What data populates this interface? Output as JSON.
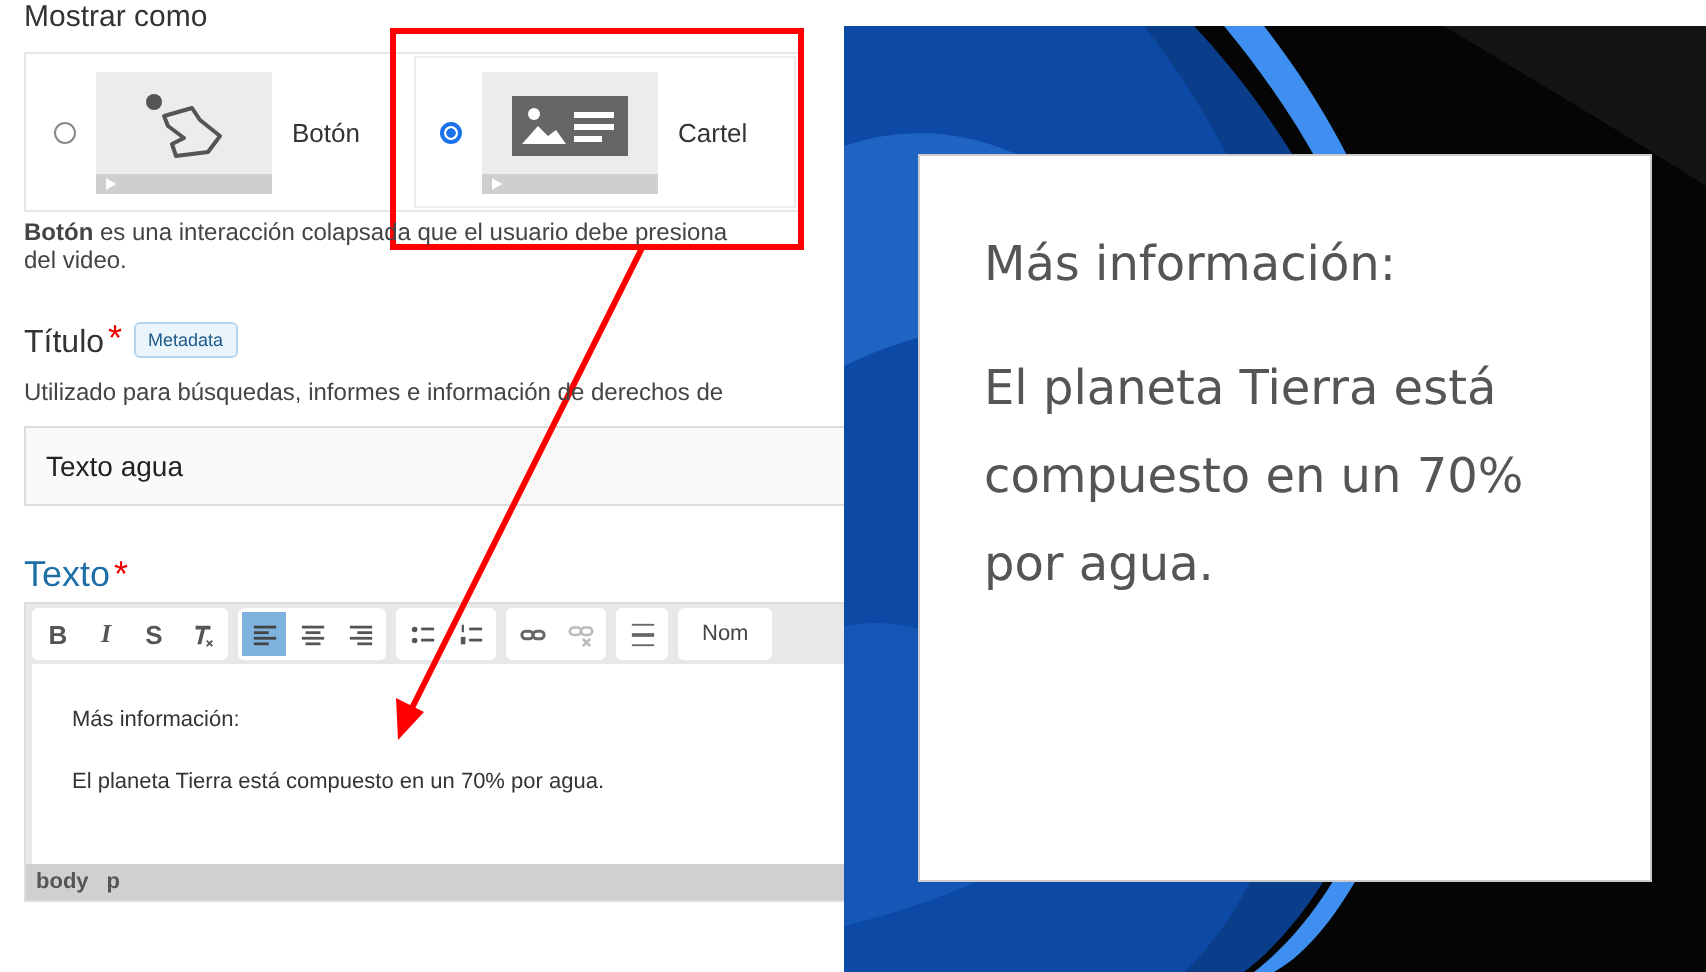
{
  "display_as": {
    "heading": "Mostrar como",
    "options": [
      {
        "label": "Botón",
        "kind": "button",
        "selected": false
      },
      {
        "label": "Cartel",
        "kind": "poster",
        "selected": true
      }
    ],
    "description": [
      "**Botón** es una interacción colapsada que el usuario debe presiona",
      "del video."
    ]
  },
  "title_field": {
    "label": "Título",
    "required_mark": "*",
    "badge": "Metadata",
    "help": "Utilizado para búsquedas, informes e información de derechos de",
    "value": "Texto agua"
  },
  "text_field": {
    "label": "Texto",
    "required_mark": "*",
    "toolbar": [
      [
        {
          "kind": "bold",
          "label": "B",
          "selected": false
        },
        {
          "kind": "italic",
          "label": "I",
          "selected": false
        },
        {
          "kind": "strike",
          "label": "S",
          "selected": false
        },
        {
          "kind": "clear",
          "selected": false
        }
      ],
      [
        {
          "kind": "align-left",
          "selected": true
        },
        {
          "kind": "align-center",
          "selected": false
        },
        {
          "kind": "align-right",
          "selected": false
        }
      ],
      [
        {
          "kind": "bullets",
          "selected": false
        },
        {
          "kind": "numbers",
          "selected": false
        }
      ],
      [
        {
          "kind": "link",
          "selected": false
        },
        {
          "kind": "unlink",
          "selected": false
        }
      ],
      [
        {
          "kind": "rule",
          "selected": false
        }
      ]
    ],
    "format_select": "Nom",
    "paragraphs": [
      "Más información:",
      "El planeta Tierra está compuesto en un 70% por agua."
    ],
    "path": [
      "body",
      "p"
    ]
  },
  "preview": {
    "heading": "Más información:",
    "body": "El planeta Tierra está compuesto en un 70% por agua."
  }
}
